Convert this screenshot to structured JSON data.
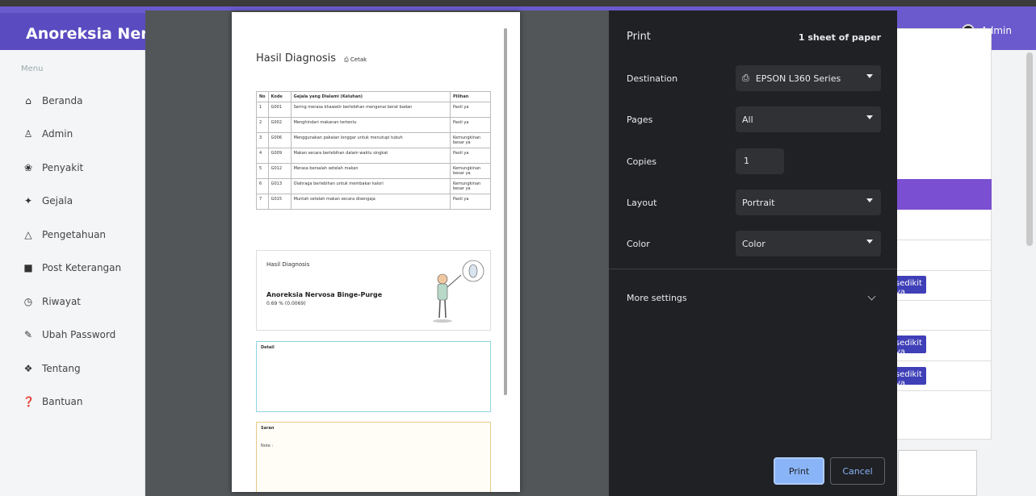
{
  "app": {
    "brand": "Anoreksia Nervo",
    "user": "Admin",
    "menu_label": "Menu",
    "sidebar": [
      {
        "label": "Beranda",
        "icon": "home-icon"
      },
      {
        "label": "Admin",
        "icon": "user-icon"
      },
      {
        "label": "Penyakit",
        "icon": "bug-icon"
      },
      {
        "label": "Gejala",
        "icon": "magic-wand-icon"
      },
      {
        "label": "Pengetahuan",
        "icon": "flask-icon"
      },
      {
        "label": "Post Keterangan",
        "icon": "document-icon"
      },
      {
        "label": "Riwayat",
        "icon": "history-icon"
      },
      {
        "label": "Ubah Password",
        "icon": "edit-icon"
      },
      {
        "label": "Tentang",
        "icon": "info-icon"
      },
      {
        "label": "Bantuan",
        "icon": "question-icon"
      }
    ],
    "yes_button": "sedikit ya"
  },
  "preview": {
    "heading": "Hasil Diagnosis",
    "print_link": "Cetak",
    "table": {
      "columns": [
        "No",
        "Kode",
        "Gejala yang Dialami (Keluhan)",
        "Pilihan"
      ],
      "rows": [
        [
          "1",
          "G001",
          "Sering merasa khawatir berlebihan mengenai berat badan",
          "Pasti ya"
        ],
        [
          "2",
          "G002",
          "Menghindari makanan tertentu",
          "Pasti ya"
        ],
        [
          "3",
          "G006",
          "Menggunakan pakaian longgar untuk menutupi tubuh",
          "Kemungkinan besar ya"
        ],
        [
          "4",
          "G009",
          "Makan secara berlebihan dalam waktu singkat",
          "Pasti ya"
        ],
        [
          "5",
          "G012",
          "Merasa bersalah setelah makan",
          "Kemungkinan besar ya"
        ],
        [
          "6",
          "G013",
          "Olahraga berlebihan untuk membakar kalori",
          "Kemungkinan besar ya"
        ],
        [
          "7",
          "G015",
          "Muntah setelah makan secara disengaja",
          "Pasti ya"
        ]
      ]
    },
    "result_title": "Hasil Diagnosis",
    "result_name": "Anoreksia Nervosa Binge-Purge",
    "result_pct": "0.69 % (0.0069)",
    "detail_title": "Detail",
    "saran_title": "Saran",
    "saran_text2": "Note :"
  },
  "print": {
    "title": "Print",
    "sheets": "1 sheet of paper",
    "destination_label": "Destination",
    "destination_value": "EPSON L360 Series",
    "pages_label": "Pages",
    "pages_value": "All",
    "copies_label": "Copies",
    "copies_value": "1",
    "layout_label": "Layout",
    "layout_value": "Portrait",
    "color_label": "Color",
    "color_value": "Color",
    "more_settings": "More settings",
    "print_button": "Print",
    "cancel_button": "Cancel"
  }
}
